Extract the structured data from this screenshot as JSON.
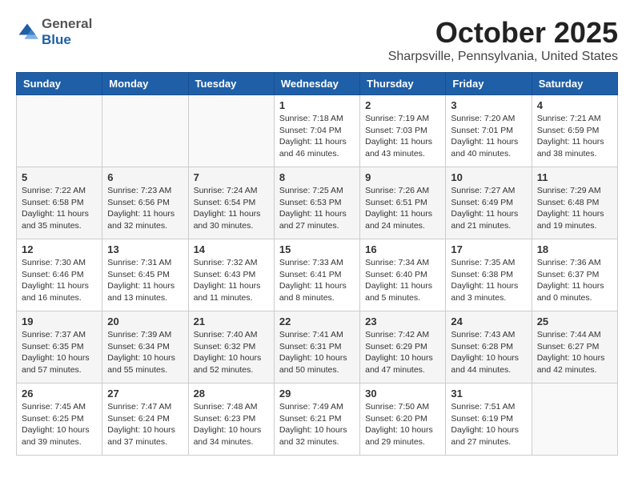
{
  "header": {
    "logo_general": "General",
    "logo_blue": "Blue",
    "month_title": "October 2025",
    "location": "Sharpsville, Pennsylvania, United States"
  },
  "weekdays": [
    "Sunday",
    "Monday",
    "Tuesday",
    "Wednesday",
    "Thursday",
    "Friday",
    "Saturday"
  ],
  "weeks": [
    [
      {
        "day": "",
        "text": ""
      },
      {
        "day": "",
        "text": ""
      },
      {
        "day": "",
        "text": ""
      },
      {
        "day": "1",
        "text": "Sunrise: 7:18 AM\nSunset: 7:04 PM\nDaylight: 11 hours and 46 minutes."
      },
      {
        "day": "2",
        "text": "Sunrise: 7:19 AM\nSunset: 7:03 PM\nDaylight: 11 hours and 43 minutes."
      },
      {
        "day": "3",
        "text": "Sunrise: 7:20 AM\nSunset: 7:01 PM\nDaylight: 11 hours and 40 minutes."
      },
      {
        "day": "4",
        "text": "Sunrise: 7:21 AM\nSunset: 6:59 PM\nDaylight: 11 hours and 38 minutes."
      }
    ],
    [
      {
        "day": "5",
        "text": "Sunrise: 7:22 AM\nSunset: 6:58 PM\nDaylight: 11 hours and 35 minutes."
      },
      {
        "day": "6",
        "text": "Sunrise: 7:23 AM\nSunset: 6:56 PM\nDaylight: 11 hours and 32 minutes."
      },
      {
        "day": "7",
        "text": "Sunrise: 7:24 AM\nSunset: 6:54 PM\nDaylight: 11 hours and 30 minutes."
      },
      {
        "day": "8",
        "text": "Sunrise: 7:25 AM\nSunset: 6:53 PM\nDaylight: 11 hours and 27 minutes."
      },
      {
        "day": "9",
        "text": "Sunrise: 7:26 AM\nSunset: 6:51 PM\nDaylight: 11 hours and 24 minutes."
      },
      {
        "day": "10",
        "text": "Sunrise: 7:27 AM\nSunset: 6:49 PM\nDaylight: 11 hours and 21 minutes."
      },
      {
        "day": "11",
        "text": "Sunrise: 7:29 AM\nSunset: 6:48 PM\nDaylight: 11 hours and 19 minutes."
      }
    ],
    [
      {
        "day": "12",
        "text": "Sunrise: 7:30 AM\nSunset: 6:46 PM\nDaylight: 11 hours and 16 minutes."
      },
      {
        "day": "13",
        "text": "Sunrise: 7:31 AM\nSunset: 6:45 PM\nDaylight: 11 hours and 13 minutes."
      },
      {
        "day": "14",
        "text": "Sunrise: 7:32 AM\nSunset: 6:43 PM\nDaylight: 11 hours and 11 minutes."
      },
      {
        "day": "15",
        "text": "Sunrise: 7:33 AM\nSunset: 6:41 PM\nDaylight: 11 hours and 8 minutes."
      },
      {
        "day": "16",
        "text": "Sunrise: 7:34 AM\nSunset: 6:40 PM\nDaylight: 11 hours and 5 minutes."
      },
      {
        "day": "17",
        "text": "Sunrise: 7:35 AM\nSunset: 6:38 PM\nDaylight: 11 hours and 3 minutes."
      },
      {
        "day": "18",
        "text": "Sunrise: 7:36 AM\nSunset: 6:37 PM\nDaylight: 11 hours and 0 minutes."
      }
    ],
    [
      {
        "day": "19",
        "text": "Sunrise: 7:37 AM\nSunset: 6:35 PM\nDaylight: 10 hours and 57 minutes."
      },
      {
        "day": "20",
        "text": "Sunrise: 7:39 AM\nSunset: 6:34 PM\nDaylight: 10 hours and 55 minutes."
      },
      {
        "day": "21",
        "text": "Sunrise: 7:40 AM\nSunset: 6:32 PM\nDaylight: 10 hours and 52 minutes."
      },
      {
        "day": "22",
        "text": "Sunrise: 7:41 AM\nSunset: 6:31 PM\nDaylight: 10 hours and 50 minutes."
      },
      {
        "day": "23",
        "text": "Sunrise: 7:42 AM\nSunset: 6:29 PM\nDaylight: 10 hours and 47 minutes."
      },
      {
        "day": "24",
        "text": "Sunrise: 7:43 AM\nSunset: 6:28 PM\nDaylight: 10 hours and 44 minutes."
      },
      {
        "day": "25",
        "text": "Sunrise: 7:44 AM\nSunset: 6:27 PM\nDaylight: 10 hours and 42 minutes."
      }
    ],
    [
      {
        "day": "26",
        "text": "Sunrise: 7:45 AM\nSunset: 6:25 PM\nDaylight: 10 hours and 39 minutes."
      },
      {
        "day": "27",
        "text": "Sunrise: 7:47 AM\nSunset: 6:24 PM\nDaylight: 10 hours and 37 minutes."
      },
      {
        "day": "28",
        "text": "Sunrise: 7:48 AM\nSunset: 6:23 PM\nDaylight: 10 hours and 34 minutes."
      },
      {
        "day": "29",
        "text": "Sunrise: 7:49 AM\nSunset: 6:21 PM\nDaylight: 10 hours and 32 minutes."
      },
      {
        "day": "30",
        "text": "Sunrise: 7:50 AM\nSunset: 6:20 PM\nDaylight: 10 hours and 29 minutes."
      },
      {
        "day": "31",
        "text": "Sunrise: 7:51 AM\nSunset: 6:19 PM\nDaylight: 10 hours and 27 minutes."
      },
      {
        "day": "",
        "text": ""
      }
    ]
  ]
}
